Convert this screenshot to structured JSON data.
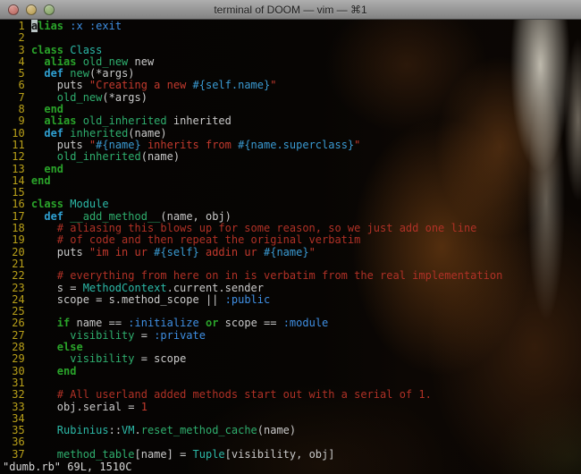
{
  "window": {
    "title": "terminal of DOOM — vim — ⌘1",
    "controls": [
      "close",
      "minimize",
      "zoom"
    ]
  },
  "statusline": "\"dumb.rb\" 69L, 1510C",
  "cursor": {
    "line": 1,
    "col": 1
  },
  "colors": {
    "fg": "#c9c9c9",
    "lineno": "#b9a019",
    "kw": "#2aa32a",
    "def": "#2f9fd0",
    "const": "#2cb9a8",
    "sym": "#3f8fe3",
    "str": "#c2392d",
    "com": "#b03126",
    "interp": "#3a9ad2",
    "num": "#c2392d",
    "id": "#2fae6e",
    "cursorBg": "#b9c4c4",
    "cursorFg": "#101010",
    "status": "#d6d6d6",
    "titleTop": "#aeaeae",
    "titleBottom": "#828282",
    "titleText": "#1e1e1e",
    "lightClose": "#b4635c",
    "lightMin": "#b49a4e",
    "lightZoom": "#7f9e62"
  },
  "code": {
    "lines": [
      {
        "n": 1,
        "s": [
          [
            "a",
            "cur"
          ],
          [
            "lias",
            "kw"
          ],
          [
            " ",
            ""
          ],
          [
            ":x",
            "sym"
          ],
          [
            " ",
            ""
          ],
          [
            ":exit",
            "sym"
          ]
        ]
      },
      {
        "n": 2,
        "s": []
      },
      {
        "n": 3,
        "s": [
          [
            "class",
            "kw"
          ],
          [
            " ",
            ""
          ],
          [
            "Class",
            "const"
          ]
        ]
      },
      {
        "n": 4,
        "s": [
          [
            "  ",
            ""
          ],
          [
            "alias",
            "kw"
          ],
          [
            " ",
            ""
          ],
          [
            "old_new",
            "id"
          ],
          [
            " new",
            ""
          ]
        ]
      },
      {
        "n": 5,
        "s": [
          [
            "  ",
            ""
          ],
          [
            "def",
            "def"
          ],
          [
            " ",
            ""
          ],
          [
            "new",
            "id"
          ],
          [
            "(*args)",
            ""
          ]
        ]
      },
      {
        "n": 6,
        "s": [
          [
            "    puts ",
            ""
          ],
          [
            "\"Creating a new ",
            "str"
          ],
          [
            "#{self.name}",
            "interp"
          ],
          [
            "\"",
            "str"
          ]
        ]
      },
      {
        "n": 7,
        "s": [
          [
            "    ",
            ""
          ],
          [
            "old_new",
            "id"
          ],
          [
            "(*args)",
            ""
          ]
        ]
      },
      {
        "n": 8,
        "s": [
          [
            "  ",
            ""
          ],
          [
            "end",
            "kw"
          ]
        ]
      },
      {
        "n": 9,
        "s": [
          [
            "  ",
            ""
          ],
          [
            "alias",
            "kw"
          ],
          [
            " ",
            ""
          ],
          [
            "old_inherited",
            "id"
          ],
          [
            " inherited",
            ""
          ]
        ]
      },
      {
        "n": 10,
        "s": [
          [
            "  ",
            ""
          ],
          [
            "def",
            "def"
          ],
          [
            " ",
            ""
          ],
          [
            "inherited",
            "id"
          ],
          [
            "(name)",
            ""
          ]
        ]
      },
      {
        "n": 11,
        "s": [
          [
            "    puts ",
            ""
          ],
          [
            "\"",
            "str"
          ],
          [
            "#{name}",
            "interp"
          ],
          [
            " inherits from ",
            "str"
          ],
          [
            "#{name.superclass}",
            "interp"
          ],
          [
            "\"",
            "str"
          ]
        ]
      },
      {
        "n": 12,
        "s": [
          [
            "    ",
            ""
          ],
          [
            "old_inherited",
            "id"
          ],
          [
            "(name)",
            ""
          ]
        ]
      },
      {
        "n": 13,
        "s": [
          [
            "  ",
            ""
          ],
          [
            "end",
            "kw"
          ]
        ]
      },
      {
        "n": 14,
        "s": [
          [
            "end",
            "kw"
          ]
        ]
      },
      {
        "n": 15,
        "s": []
      },
      {
        "n": 16,
        "s": [
          [
            "class",
            "kw"
          ],
          [
            " ",
            ""
          ],
          [
            "Module",
            "const"
          ]
        ]
      },
      {
        "n": 17,
        "s": [
          [
            "  ",
            ""
          ],
          [
            "def",
            "def"
          ],
          [
            " ",
            ""
          ],
          [
            "__add_method__",
            "id"
          ],
          [
            "(name, obj)",
            ""
          ]
        ]
      },
      {
        "n": 18,
        "s": [
          [
            "    ",
            ""
          ],
          [
            "# aliasing this blows up for some reason, so we just add one line",
            "com"
          ]
        ]
      },
      {
        "n": 19,
        "s": [
          [
            "    ",
            ""
          ],
          [
            "# of code and then repeat the original verbatim",
            "com"
          ]
        ]
      },
      {
        "n": 20,
        "s": [
          [
            "    puts ",
            ""
          ],
          [
            "\"im in ur ",
            "str"
          ],
          [
            "#{self}",
            "interp"
          ],
          [
            " addin ur ",
            "str"
          ],
          [
            "#{name}",
            "interp"
          ],
          [
            "\"",
            "str"
          ]
        ]
      },
      {
        "n": 21,
        "s": []
      },
      {
        "n": 22,
        "s": [
          [
            "    ",
            ""
          ],
          [
            "# everything from here on in is verbatim from the real implementation",
            "com"
          ]
        ]
      },
      {
        "n": 23,
        "s": [
          [
            "    s = ",
            ""
          ],
          [
            "MethodContext",
            "const"
          ],
          [
            ".current.sender",
            ""
          ]
        ]
      },
      {
        "n": 24,
        "s": [
          [
            "    scope = s.method_scope || ",
            ""
          ],
          [
            ":public",
            "sym"
          ]
        ]
      },
      {
        "n": 25,
        "s": []
      },
      {
        "n": 26,
        "s": [
          [
            "    ",
            ""
          ],
          [
            "if",
            "kw"
          ],
          [
            " name == ",
            ""
          ],
          [
            ":initialize",
            "sym"
          ],
          [
            " ",
            ""
          ],
          [
            "or",
            "kw"
          ],
          [
            " scope == ",
            ""
          ],
          [
            ":module",
            "sym"
          ]
        ]
      },
      {
        "n": 27,
        "s": [
          [
            "      ",
            ""
          ],
          [
            "visibility",
            "id"
          ],
          [
            " = ",
            ""
          ],
          [
            ":private",
            "sym"
          ]
        ]
      },
      {
        "n": 28,
        "s": [
          [
            "    ",
            ""
          ],
          [
            "else",
            "kw"
          ]
        ]
      },
      {
        "n": 29,
        "s": [
          [
            "      ",
            ""
          ],
          [
            "visibility",
            "id"
          ],
          [
            " = scope",
            ""
          ]
        ]
      },
      {
        "n": 30,
        "s": [
          [
            "    ",
            ""
          ],
          [
            "end",
            "kw"
          ]
        ]
      },
      {
        "n": 31,
        "s": []
      },
      {
        "n": 32,
        "s": [
          [
            "    ",
            ""
          ],
          [
            "# All userland added methods start out with a serial of 1.",
            "com"
          ]
        ]
      },
      {
        "n": 33,
        "s": [
          [
            "    obj.serial = ",
            ""
          ],
          [
            "1",
            "num"
          ]
        ]
      },
      {
        "n": 34,
        "s": []
      },
      {
        "n": 35,
        "s": [
          [
            "    ",
            ""
          ],
          [
            "Rubinius",
            "const"
          ],
          [
            "::",
            ""
          ],
          [
            "VM",
            "const"
          ],
          [
            ".",
            ""
          ],
          [
            "reset_method_cache",
            "id"
          ],
          [
            "(name)",
            ""
          ]
        ]
      },
      {
        "n": 36,
        "s": []
      },
      {
        "n": 37,
        "s": [
          [
            "    ",
            ""
          ],
          [
            "method_table",
            "id"
          ],
          [
            "[name] = ",
            ""
          ],
          [
            "Tuple",
            "const"
          ],
          [
            "[visibility, obj]",
            ""
          ]
        ]
      }
    ]
  }
}
